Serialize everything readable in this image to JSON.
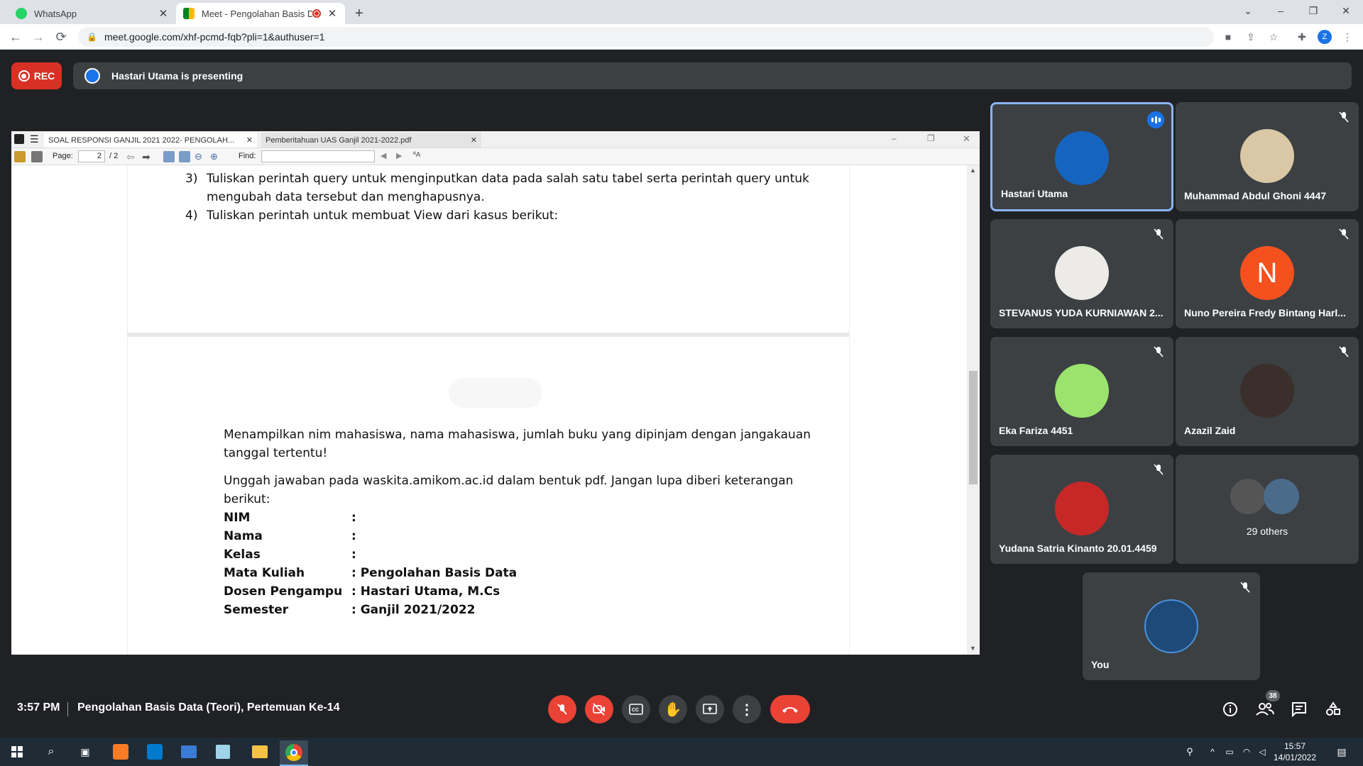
{
  "browser": {
    "tabs": [
      {
        "title": "WhatsApp",
        "favicon": "whatsapp-icon"
      },
      {
        "title": "Meet - Pengolahan Basis Da",
        "favicon": "meet-icon"
      }
    ],
    "url": "meet.google.com/xhf-pcmd-fqb?pli=1&authuser=1",
    "profile_letter": "Z"
  },
  "meet": {
    "rec_label": "REC",
    "presenting_text": "Hastari Utama is presenting",
    "time": "3:57 PM",
    "meeting_title": "Pengolahan Basis Data (Teori), Pertemuan Ke-14",
    "participant_count": "38",
    "participants": [
      {
        "name": "Hastari Utama"
      },
      {
        "name": "Muhammad Abdul Ghoni 4447"
      },
      {
        "name": "STEVANUS YUDA KURNIAWAN 2..."
      },
      {
        "name": "Nuno Pereira Fredy Bintang Harl...",
        "initial": "N"
      },
      {
        "name": "Eka Fariza 4451"
      },
      {
        "name": "Azazil Zaid"
      },
      {
        "name": "Yudana Satria Kinanto 20.01.4459"
      },
      {
        "name": "29 others"
      },
      {
        "name": "You"
      }
    ],
    "colors": {
      "accent": "#1a73e8",
      "danger": "#ea4335",
      "tile": "#3c4043",
      "bg": "#202124"
    }
  },
  "pdf": {
    "tabs": [
      "SOAL RESPONSI GANJIL 2021 2022- PENGOLAH...",
      "Pemberitahuan UAS Ganjil 2021-2022.pdf"
    ],
    "page_label": "Page:",
    "page_value": "2",
    "page_total": "/ 2",
    "find_label": "Find:",
    "lines": {
      "n3": "3)",
      "l3a": "Tuliskan perintah query untuk menginputkan data pada salah satu tabel serta perintah query untuk",
      "l3b": "mengubah data tersebut dan menghapusnya.",
      "n4": "4)",
      "l4": "Tuliskan perintah untuk membuat View dari kasus berikut:",
      "p1a": "Menampilkan nim mahasiswa, nama mahasiswa, jumlah buku yang dipinjam dengan jangakauan",
      "p1b": "tanggal tertentu!",
      "p2a": "Unggah jawaban pada waskita.amikom.ac.id dalam bentuk pdf. Jangan lupa diberi keterangan",
      "p2b": "berikut:"
    },
    "fields": [
      {
        "label": "NIM",
        "value": ":"
      },
      {
        "label": "Nama",
        "value": ":"
      },
      {
        "label": "Kelas",
        "value": ":"
      },
      {
        "label": "Mata Kuliah",
        "value": ": Pengolahan Basis Data"
      },
      {
        "label": "Dosen Pengampu",
        "value": ": Hastari Utama, M.Cs"
      },
      {
        "label": "Semester",
        "value": ": Ganjil 2021/2022"
      }
    ]
  },
  "taskbar": {
    "time": "15:57",
    "date": "14/01/2022"
  }
}
